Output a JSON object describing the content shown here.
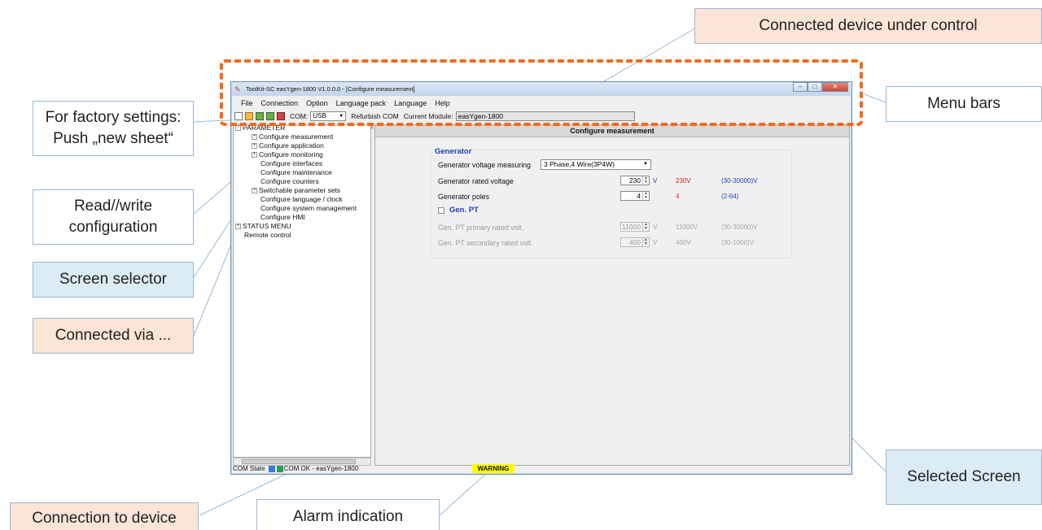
{
  "callouts": {
    "connected_device": "Connected device under control",
    "menu_bars": "Menu bars",
    "factory_settings": "For factory settings: Push „new sheet“",
    "read_write": "Read//write configuration",
    "screen_selector": "Screen selector",
    "connected_via": "Connected via ...",
    "selected_screen": "Selected Screen",
    "connection_to_device": "Connection to device",
    "alarm_indication": "Alarm indication"
  },
  "window": {
    "title": "ToolKit-SC easYgen-1800  V1.0.0.0 - [Configure measurement]",
    "menu": [
      "File",
      "Connection",
      "Option",
      "Language pack",
      "Language",
      "Help"
    ],
    "toolbar": {
      "com_label": "COM:",
      "com_value": "USB",
      "refurbish_label": "Refurbish COM",
      "module_label": "Current Module:",
      "module_value": "easYgen-1800"
    }
  },
  "tree": {
    "root": "PARAMETER",
    "items": [
      "Configure measurement",
      "Configure application",
      "Configure monitoring",
      "Configure interfaces",
      "Configure maintenance",
      "Configure counters",
      "Switchable parameter sets",
      "Configure language / clock",
      "Configure system management",
      "Configure HMI"
    ],
    "status_menu": "STATUS MENU",
    "remote_control": "Remote control",
    "scroll_mark": "III"
  },
  "panel": {
    "header": "Configure measurement",
    "generator": {
      "title": "Generator",
      "voltage_measuring_label": "Generator voltage measuring",
      "voltage_measuring_value": "3 Phase,4 Wire(3P4W)",
      "rated_voltage_label": "Generator rated voltage",
      "rated_voltage_value": "230",
      "rated_voltage_unit": "V",
      "rated_voltage_current": "230V",
      "rated_voltage_range": "(30-30000)V",
      "poles_label": "Generator poles",
      "poles_value": "4",
      "poles_current": "4",
      "poles_range": "(2-64)"
    },
    "gen_pt": {
      "title": "Gen. PT",
      "primary_label": "Gen. PT primary rated volt.",
      "primary_value": "11000",
      "primary_unit": "V",
      "primary_current": "11000V",
      "primary_range": "(30-30000)V",
      "secondary_label": "Gen. PT secondary rated volt.",
      "secondary_value": "400",
      "secondary_unit": "V",
      "secondary_current": "400V",
      "secondary_range": "(30-1000)V"
    }
  },
  "status": {
    "com_state_label": "COM State",
    "com_state_value": "COM OK - easYgen-1800",
    "warning": "WARNING"
  },
  "colors": {
    "highlight_dash": "#f26b1d",
    "callout_blue": "#dcecf4",
    "callout_peach": "#fbe5d6",
    "warning": "#ffff00"
  }
}
